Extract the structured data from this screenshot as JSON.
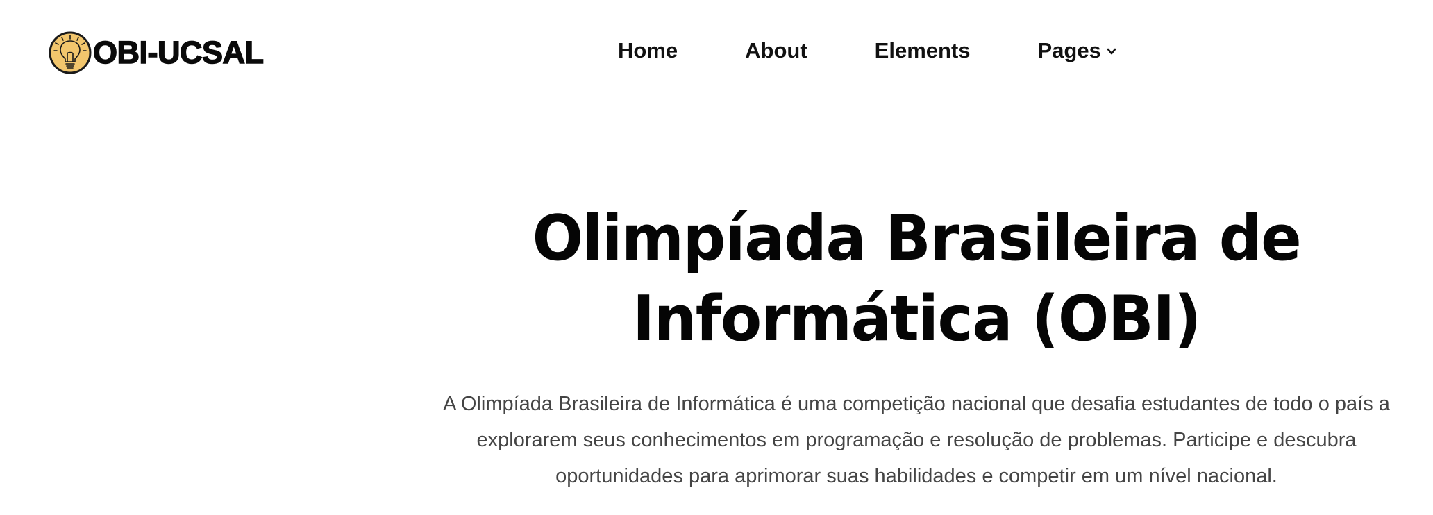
{
  "header": {
    "logo_text": "OBI-UCSAL",
    "logo_icon": "lightbulb-icon",
    "nav": {
      "home": "Home",
      "about": "About",
      "elements": "Elements",
      "pages": "Pages"
    },
    "pages_icon": "chevron-down-icon"
  },
  "hero": {
    "title_line1": "Olimpíada Brasileira de",
    "title_line2": "Informática (OBI)",
    "description": "A Olimpíada Brasileira de Informática é uma competição nacional que desafia estudantes de todo o país a explorarem seus conhecimentos em programação e resolução de problemas. Participe e descubra oportunidades para aprimorar suas habilidades e competir em um nível nacional."
  },
  "colors": {
    "logo_icon_fill": "#F2C66D",
    "text_primary": "#000000",
    "text_body": "#444444",
    "background": "#FFFFFF"
  }
}
